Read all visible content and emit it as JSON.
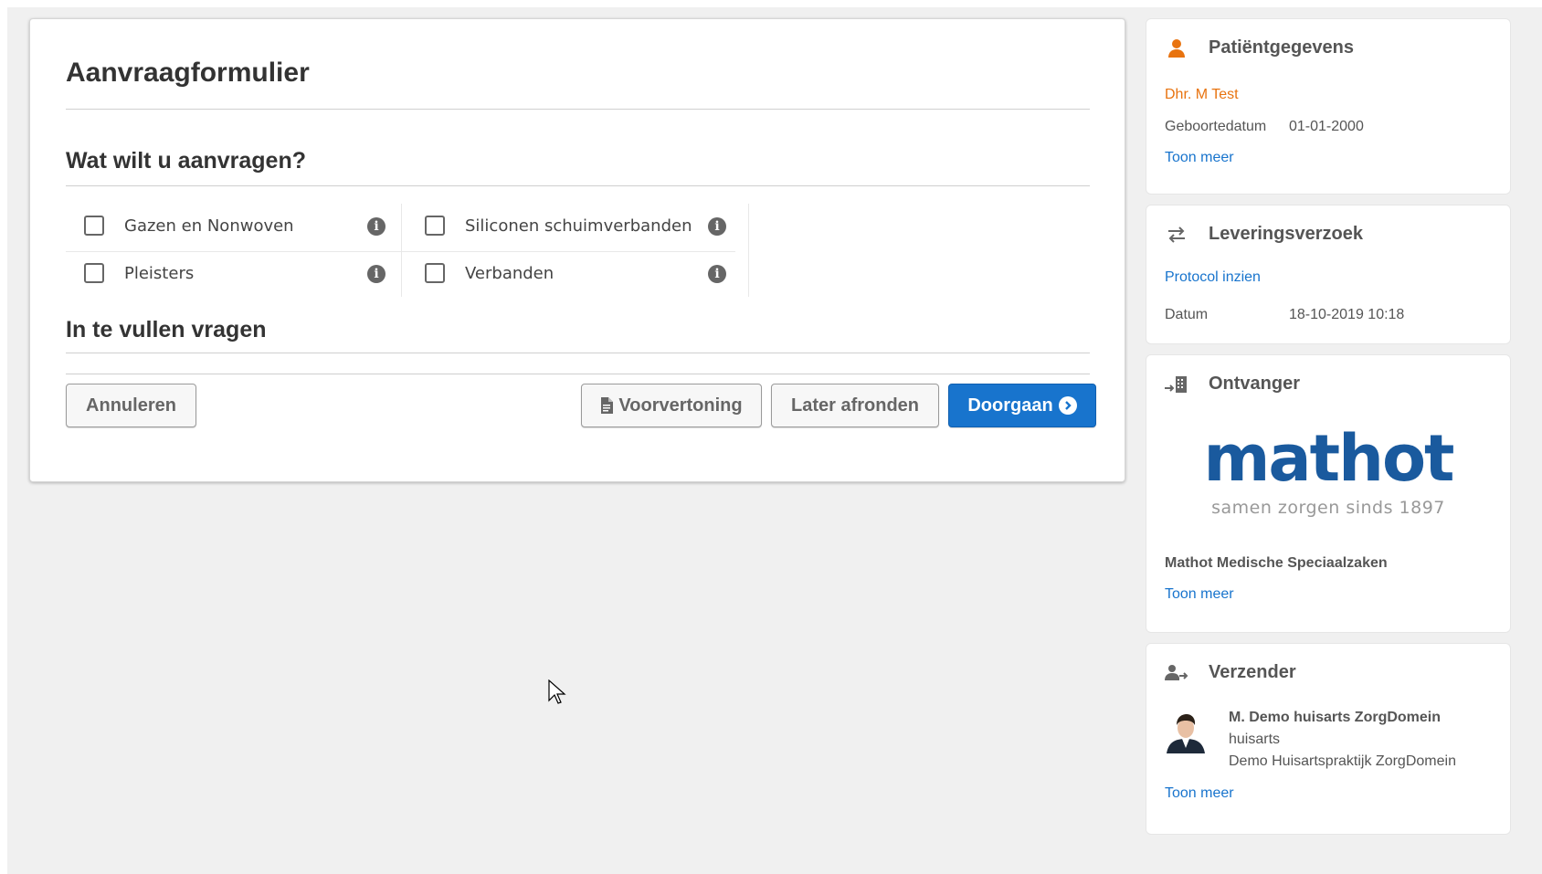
{
  "form": {
    "title": "Aanvraagformulier",
    "section_request": "Wat wilt u aanvragen?",
    "options": [
      {
        "label": "Gazen en Nonwoven",
        "checked": false
      },
      {
        "label": "Siliconen schuimverbanden",
        "checked": false
      },
      {
        "label": "Pleisters",
        "checked": false
      },
      {
        "label": "Verbanden",
        "checked": false
      }
    ],
    "info_glyph": "i",
    "section_questions": "In te vullen vragen",
    "buttons": {
      "cancel": "Annuleren",
      "preview": "Voorvertoning",
      "later": "Later afronden",
      "continue": "Doorgaan"
    }
  },
  "patient": {
    "heading": "Patiëntgegevens",
    "name": "Dhr. M Test",
    "dob_label": "Geboortedatum",
    "dob_value": "01-01-2000",
    "more": "Toon meer"
  },
  "delivery": {
    "heading": "Leveringsverzoek",
    "protocol": "Protocol inzien",
    "date_label": "Datum",
    "date_value": "18-10-2019 10:18"
  },
  "receiver": {
    "heading": "Ontvanger",
    "logo_text": "mathot",
    "logo_tagline": "samen zorgen sinds 1897",
    "org": "Mathot Medische Speciaalzaken",
    "more": "Toon meer"
  },
  "sender": {
    "heading": "Verzender",
    "name": "M. Demo huisarts ZorgDomein",
    "role": "huisarts",
    "practice": "Demo Huisartspraktijk ZorgDomein",
    "more": "Toon meer"
  },
  "colors": {
    "primary": "#1874cd",
    "accent": "#e8730f",
    "logo": "#1a5a9e",
    "background": "#f0f0f0"
  },
  "icons": {
    "patient": "person-icon",
    "delivery": "swap-arrows-icon",
    "receiver": "building-arrow-icon",
    "sender": "person-arrow-icon",
    "info": "info-circle-icon",
    "preview": "document-icon",
    "continue": "chevron-circle-right-icon"
  }
}
